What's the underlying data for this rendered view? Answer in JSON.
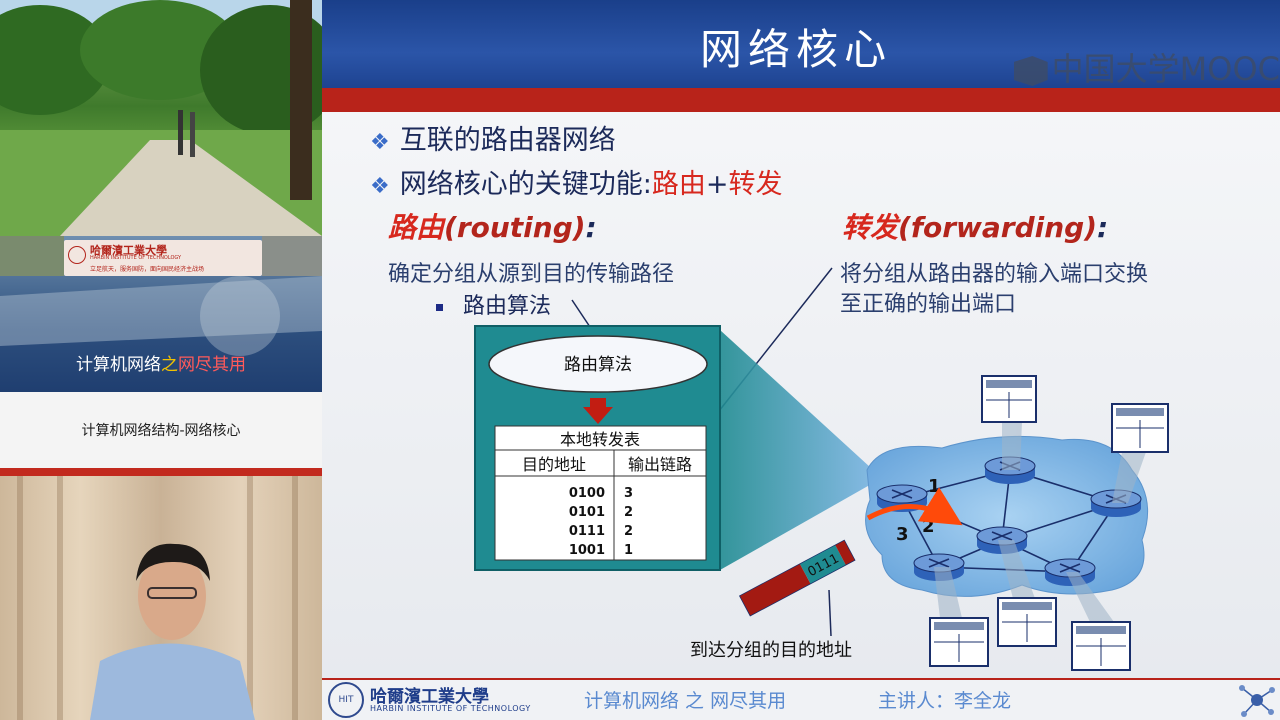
{
  "left_panel": {
    "banner_school": "哈爾濱工業大學",
    "banner_school_en": "HARBIN INSTITUTE OF TECHNOLOGY",
    "banner_slogan": "立足航天，服务国防，面向国民经济主战场",
    "course_title_a": "计算机网络",
    "course_title_b": "之",
    "course_title_c": "网尽其用",
    "lecture_caption": "计算机网络结构-网络核心"
  },
  "slide": {
    "title": "网络核心",
    "watermark": "中国大学MOOC",
    "bullet1": "互联的路由器网络",
    "bullet2_prefix": "网络核心的关键功能:",
    "bullet2_routing": "路由",
    "bullet2_plus": "+",
    "bullet2_forwarding": "转发",
    "routing_heading_cn": "路由",
    "routing_heading_en": "(routing)",
    "routing_heading_colon": ":",
    "routing_desc": "确定分组从源到目的传输路径",
    "routing_sub": "路由算法",
    "forwarding_heading_cn": "转发",
    "forwarding_heading_en": "(forwarding)",
    "forwarding_heading_colon": ":",
    "forwarding_desc_line1": "将分组从路由器的输入端口交换",
    "forwarding_desc_line2": "至正确的输出端口",
    "diagram": {
      "algorithm_label": "路由算法",
      "table_title": "本地转发表",
      "col_dest": "目的地址",
      "col_link": "输出链路",
      "rows": [
        {
          "dest": "0100",
          "link": "3"
        },
        {
          "dest": "0101",
          "link": "2"
        },
        {
          "dest": "0111",
          "link": "2"
        },
        {
          "dest": "1001",
          "link": "1"
        }
      ],
      "packet_header": "0111",
      "link_label_1": "1",
      "link_label_2": "2",
      "link_label_3": "3",
      "arrival_caption": "到达分组的目的地址"
    },
    "footer": {
      "school": "哈爾濱工業大學",
      "school_en": "HARBIN INSTITUTE OF TECHNOLOGY",
      "course": "计算机网络 之 网尽其用",
      "teacher": "主讲人：李全龙"
    }
  },
  "colors": {
    "header_blue": "#2b55a8",
    "accent_red": "#b8231a",
    "network_cloud": "#7fb6e6",
    "table_teal": "#1f8b91"
  }
}
